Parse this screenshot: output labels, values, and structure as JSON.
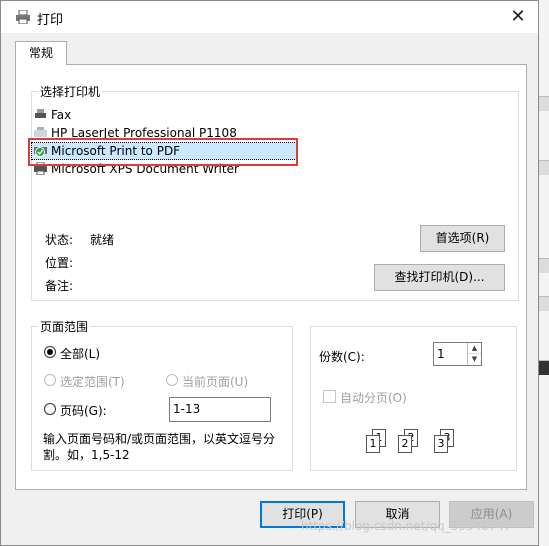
{
  "window": {
    "title": "打印",
    "close_glyph": "✕"
  },
  "tabs": [
    {
      "label": "常规"
    }
  ],
  "select_printer": {
    "legend": "选择打印机",
    "printers": [
      {
        "name": "Fax",
        "icon": "fax-icon"
      },
      {
        "name": "HP LaserJet Professional P1108",
        "icon": "printer-icon"
      },
      {
        "name": "Microsoft Print to PDF",
        "icon": "printer-default-icon",
        "selected": true
      },
      {
        "name": "Microsoft XPS Document Writer",
        "icon": "printer-icon"
      }
    ],
    "status_label": "状态:",
    "status_value": "就绪",
    "location_label": "位置:",
    "comment_label": "备注:",
    "preferences_button": "首选项(R)",
    "find_printer_button": "查找打印机(D)..."
  },
  "page_range": {
    "legend": "页面范围",
    "all_label": "全部(L)",
    "selection_label": "选定范围(T)",
    "current_page_label": "当前页面(U)",
    "pages_label": "页码(G):",
    "pages_value": "1-13",
    "hint": "输入页面号码和/或页面范围，以英文逗号分割。如，1,5-12"
  },
  "copies": {
    "label": "份数(C):",
    "value": "1",
    "collate_label": "自动分页(O)",
    "collate_pages": [
      "1",
      "1",
      "2",
      "2",
      "3",
      "3"
    ]
  },
  "buttons": {
    "print": "打印(P)",
    "cancel": "取消",
    "apply": "应用(A)"
  },
  "watermark": "https://blog.csdn.net/qq_33548747",
  "colors": {
    "highlight_box": "#e03a3a",
    "selection_bg": "#cce8ff",
    "accent": "#0078d7"
  }
}
